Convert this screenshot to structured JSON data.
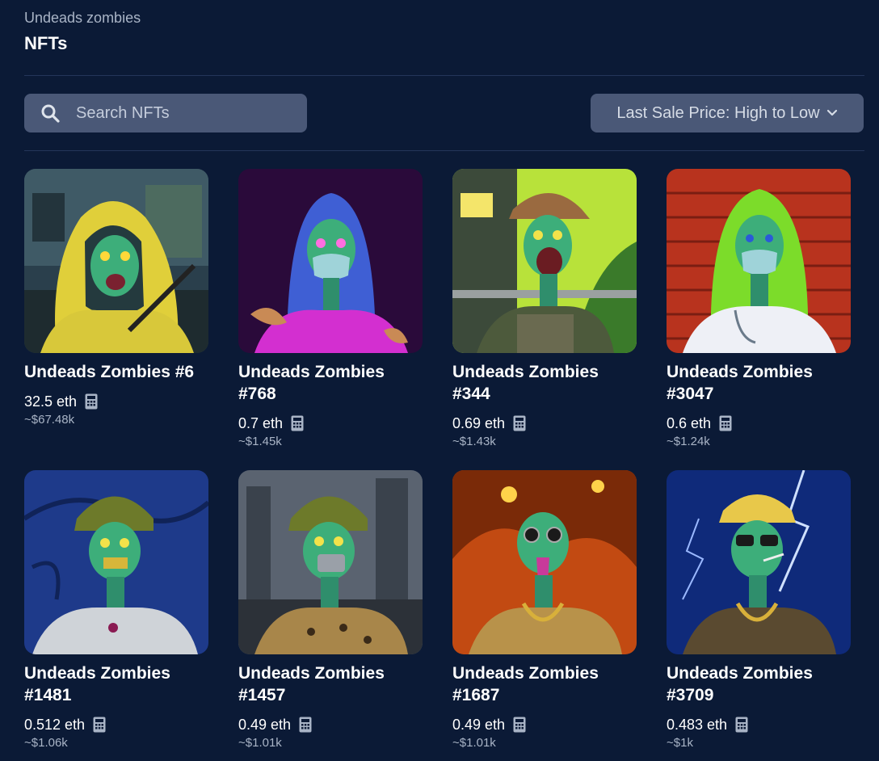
{
  "header": {
    "collection": "Undeads zombies",
    "title": "NFTs"
  },
  "search": {
    "placeholder": "Search NFTs",
    "icon": "search-icon"
  },
  "sort": {
    "label": "Last Sale Price: High to Low",
    "icon": "chevron-down-icon"
  },
  "nfts": [
    {
      "title": "Undeads Zombies #6",
      "price": "32.5 eth",
      "usd": "~$67.48k"
    },
    {
      "title": "Undeads Zombies #768",
      "price": "0.7 eth",
      "usd": "~$1.45k"
    },
    {
      "title": "Undeads Zombies #344",
      "price": "0.69 eth",
      "usd": "~$1.43k"
    },
    {
      "title": "Undeads Zombies #3047",
      "price": "0.6 eth",
      "usd": "~$1.24k"
    },
    {
      "title": "Undeads Zombies #1481",
      "price": "0.512 eth",
      "usd": "~$1.06k"
    },
    {
      "title": "Undeads Zombies #1457",
      "price": "0.49 eth",
      "usd": "~$1.01k"
    },
    {
      "title": "Undeads Zombies #1687",
      "price": "0.49 eth",
      "usd": "~$1.01k"
    },
    {
      "title": "Undeads Zombies #3709",
      "price": "0.483 eth",
      "usd": "~$1k"
    }
  ],
  "colors": {
    "background": "#0b1a36",
    "control": "#4a5877",
    "muted_text": "#a9b4c6"
  }
}
